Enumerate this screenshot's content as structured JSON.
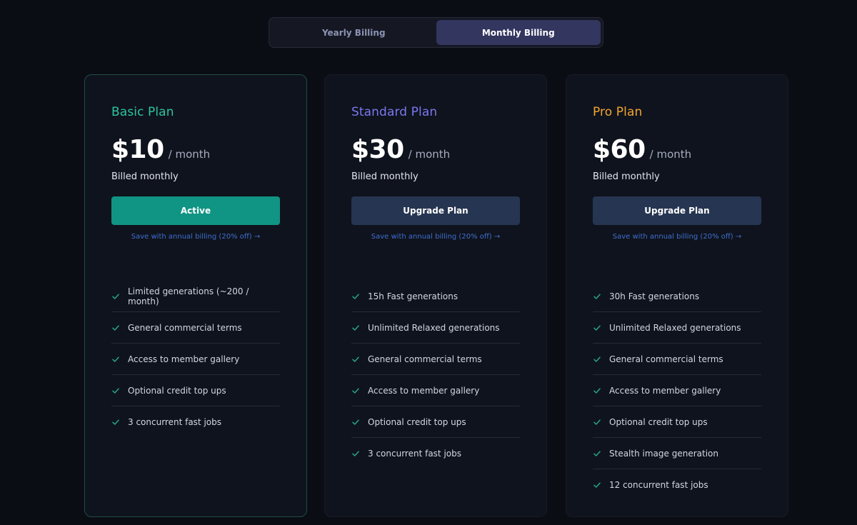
{
  "billing_toggle": {
    "options": [
      "Yearly Billing",
      "Monthly Billing"
    ],
    "selected": "Monthly Billing"
  },
  "plans": [
    {
      "name": "Basic Plan",
      "name_color": "#2dc5a0",
      "price": "$10",
      "period": "/ month",
      "billed": "Billed monthly",
      "button_label": "Active",
      "button_state": "active",
      "save_link": "Save with annual billing (20% off) →",
      "features": [
        "Limited generations (~200 / month)",
        "General commercial terms",
        "Access to member gallery",
        "Optional credit top ups",
        "3 concurrent fast jobs"
      ]
    },
    {
      "name": "Standard Plan",
      "name_color": "#7b78f0",
      "price": "$30",
      "period": "/ month",
      "billed": "Billed monthly",
      "button_label": "Upgrade Plan",
      "button_state": "upgrade",
      "save_link": "Save with annual billing (20% off) →",
      "features": [
        "15h Fast generations",
        "Unlimited Relaxed generations",
        "General commercial terms",
        "Access to member gallery",
        "Optional credit top ups",
        "3 concurrent fast jobs"
      ]
    },
    {
      "name": "Pro Plan",
      "name_color": "#f2a630",
      "price": "$60",
      "period": "/ month",
      "billed": "Billed monthly",
      "button_label": "Upgrade Plan",
      "button_state": "upgrade",
      "save_link": "Save with annual billing (20% off) →",
      "features": [
        "30h Fast generations",
        "Unlimited Relaxed generations",
        "General commercial terms",
        "Access to member gallery",
        "Optional credit top ups",
        "Stealth image generation",
        "12 concurrent fast jobs"
      ]
    }
  ],
  "colors": {
    "background": "#0b0d14",
    "card": "#0f131d",
    "check": "#2aa38d",
    "link": "#3f6fd0",
    "active_button": "#109483",
    "upgrade_button": "#263551",
    "toggle_active": "#33365f"
  },
  "icons": {
    "feature_bullet": "check-icon"
  }
}
